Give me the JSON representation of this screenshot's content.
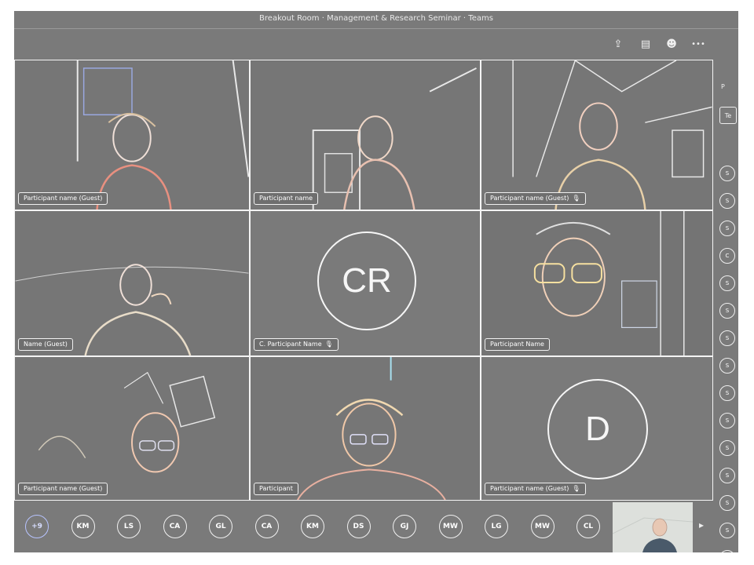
{
  "window": {
    "title": "Breakout Room · Management & Research Seminar · Teams"
  },
  "toolbar": {
    "left_label": "",
    "icons": [
      "share-icon",
      "notes-icon",
      "people-icon",
      "more-icon"
    ],
    "glyphs": {
      "share": "⇪",
      "notes": "▤",
      "people": "☻",
      "more": "•••"
    }
  },
  "tiles": [
    {
      "id": "t1",
      "name": "Participant name (Guest)",
      "type": "video"
    },
    {
      "id": "t2",
      "name": "Participant name",
      "type": "video"
    },
    {
      "id": "t3",
      "name": "Participant name (Guest)",
      "type": "video",
      "muted": true
    },
    {
      "id": "t4",
      "name": "Name (Guest)",
      "type": "video"
    },
    {
      "id": "t5",
      "name": "C. Participant Name",
      "type": "avatar",
      "initials": "CR",
      "muted": true
    },
    {
      "id": "t6",
      "name": "Participant Name",
      "type": "video"
    },
    {
      "id": "t7",
      "name": "Participant name (Guest)",
      "type": "video"
    },
    {
      "id": "t8",
      "name": "Participant",
      "type": "video"
    },
    {
      "id": "t9",
      "name": "Participant name (Guest)",
      "type": "avatar",
      "initials": "D",
      "muted": true
    }
  ],
  "mic_glyph": "🎙",
  "sidebar": {
    "label": "P",
    "button_label": "Te",
    "avatars": [
      "S",
      "S",
      "S",
      "C",
      "S",
      "S",
      "S",
      "S",
      "S",
      "S",
      "S",
      "S",
      "S",
      "S",
      "S"
    ]
  },
  "bottombar": {
    "avatars": [
      "+9",
      "KM",
      "LS",
      "CA",
      "GL",
      "CA",
      "KM",
      "DS",
      "GJ",
      "MW",
      "LG",
      "MW",
      "CL"
    ],
    "arrow": "▸"
  }
}
